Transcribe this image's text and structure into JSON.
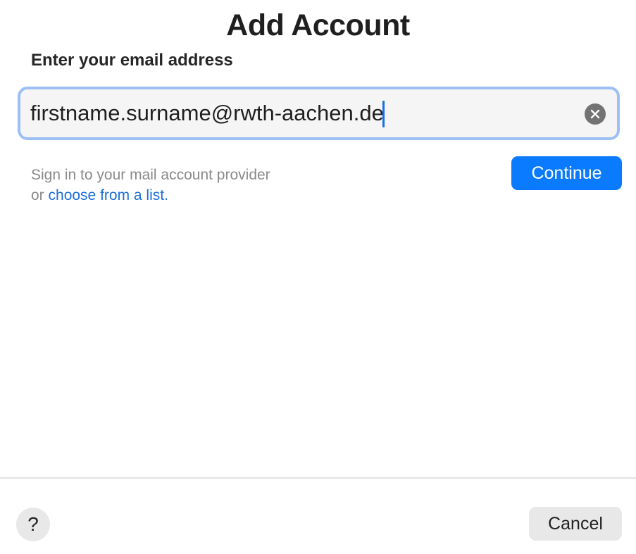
{
  "dialog": {
    "title": "Add Account",
    "field_label": "Enter your email address"
  },
  "email": {
    "value": "firstname.surname@rwth-aachen.de",
    "clear_icon": "clear-circle-x-icon"
  },
  "hint": {
    "line1": "Sign in to your mail account provider",
    "line2_prefix": "or ",
    "link_text": "choose from a list."
  },
  "buttons": {
    "continue_label": "Continue",
    "cancel_label": "Cancel",
    "help_label": "?"
  },
  "colors": {
    "accent": "#0a7bff",
    "link": "#1a6ed8",
    "focus_ring": "#9cc0f3"
  }
}
